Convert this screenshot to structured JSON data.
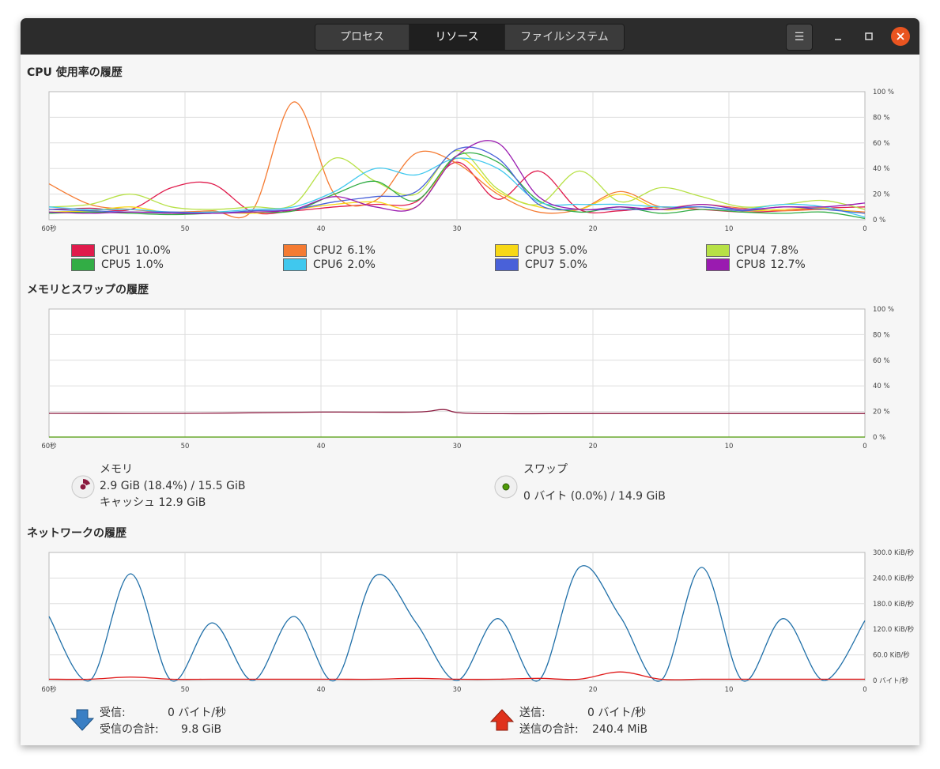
{
  "window": {
    "tabs": [
      {
        "label": "プロセス",
        "active": false
      },
      {
        "label": "リソース",
        "active": true
      },
      {
        "label": "ファイルシステム",
        "active": false
      }
    ],
    "menu_icon": "hamburger-menu-icon",
    "close_icon": "close-icon"
  },
  "cpu": {
    "title": "CPU 使用率の履歴",
    "chart_data": {
      "type": "line",
      "x": [
        60,
        57,
        54,
        51,
        48,
        45,
        42,
        39,
        36,
        33,
        30,
        27,
        24,
        21,
        18,
        15,
        12,
        9,
        6,
        3,
        0
      ],
      "xticks": [
        "60秒",
        "50",
        "40",
        "30",
        "20",
        "10",
        "0"
      ],
      "yticks": [
        "100 %",
        "80 %",
        "60 %",
        "40 %",
        "20 %",
        "0 %"
      ],
      "ylim": [
        0,
        100
      ],
      "series": [
        {
          "name": "CPU1",
          "color": "#e01b4c",
          "values": [
            8,
            9,
            8,
            25,
            28,
            6,
            7,
            10,
            12,
            14,
            45,
            16,
            38,
            8,
            7,
            10,
            8,
            6,
            7,
            9,
            10
          ]
        },
        {
          "name": "CPU2",
          "color": "#f57b32",
          "values": [
            28,
            12,
            8,
            6,
            7,
            8,
            92,
            20,
            15,
            52,
            44,
            20,
            6,
            8,
            22,
            10,
            12,
            9,
            7,
            8,
            6
          ]
        },
        {
          "name": "CPU3",
          "color": "#f7d816",
          "values": [
            6,
            7,
            10,
            5,
            6,
            5,
            8,
            12,
            14,
            10,
            48,
            22,
            10,
            8,
            20,
            8,
            10,
            7,
            8,
            9,
            5
          ]
        },
        {
          "name": "CPU4",
          "color": "#b7e146",
          "values": [
            10,
            12,
            20,
            10,
            8,
            10,
            12,
            48,
            30,
            20,
            54,
            24,
            12,
            38,
            14,
            25,
            18,
            10,
            12,
            15,
            8
          ]
        },
        {
          "name": "CPU5",
          "color": "#32ad45",
          "values": [
            5,
            6,
            5,
            4,
            5,
            6,
            7,
            20,
            30,
            15,
            50,
            45,
            15,
            6,
            10,
            5,
            8,
            6,
            5,
            6,
            1
          ]
        },
        {
          "name": "CPU6",
          "color": "#40c8ee",
          "values": [
            10,
            8,
            8,
            6,
            6,
            8,
            10,
            22,
            40,
            35,
            48,
            40,
            14,
            12,
            12,
            10,
            10,
            8,
            12,
            10,
            2
          ]
        },
        {
          "name": "CPU7",
          "color": "#4961d9",
          "values": [
            8,
            7,
            6,
            6,
            5,
            7,
            8,
            14,
            18,
            22,
            55,
            48,
            12,
            8,
            8,
            8,
            10,
            7,
            10,
            8,
            5
          ]
        },
        {
          "name": "CPU8",
          "color": "#9a1bb0",
          "values": [
            6,
            5,
            6,
            5,
            5,
            6,
            8,
            18,
            10,
            10,
            50,
            60,
            18,
            8,
            10,
            8,
            12,
            8,
            10,
            10,
            13
          ]
        }
      ],
      "legend": [
        {
          "label": "CPU1",
          "value": "10.0%",
          "color": "#e01b4c"
        },
        {
          "label": "CPU2",
          "value": "6.1%",
          "color": "#f57b32"
        },
        {
          "label": "CPU3",
          "value": "5.0%",
          "color": "#f7d816"
        },
        {
          "label": "CPU4",
          "value": "7.8%",
          "color": "#b7e146"
        },
        {
          "label": "CPU5",
          "value": "1.0%",
          "color": "#32ad45"
        },
        {
          "label": "CPU6",
          "value": "2.0%",
          "color": "#40c8ee"
        },
        {
          "label": "CPU7",
          "value": "5.0%",
          "color": "#4961d9"
        },
        {
          "label": "CPU8",
          "value": "12.7%",
          "color": "#9a1bb0"
        }
      ]
    }
  },
  "memory": {
    "title": "メモリとスワップの履歴",
    "chart_data": {
      "type": "line",
      "x": [
        60,
        50,
        40,
        33,
        31,
        29,
        20,
        10,
        0
      ],
      "xticks": [
        "60秒",
        "50",
        "40",
        "30",
        "20",
        "10",
        "0"
      ],
      "yticks": [
        "100 %",
        "80 %",
        "60 %",
        "40 %",
        "20 %",
        "0 %"
      ],
      "ylim": [
        0,
        100
      ],
      "series": [
        {
          "name": "メモリ",
          "color": "#8b1a3f",
          "values": [
            18.5,
            18.5,
            19.5,
            19.5,
            21.5,
            18.5,
            18.4,
            18.4,
            18.4
          ]
        },
        {
          "name": "スワップ",
          "color": "#4e9a06",
          "values": [
            0,
            0,
            0,
            0,
            0,
            0,
            0,
            0,
            0
          ]
        }
      ]
    },
    "mem_label": "メモリ",
    "mem_used": "2.9 GiB (18.4%) / 15.5 GiB",
    "mem_cache": "キャッシュ 12.9 GiB",
    "swap_label": "スワップ",
    "swap_used": "0 バイト (0.0%) / 14.9 GiB",
    "mem_color": "#8b1a3f",
    "swap_color": "#4e9a06",
    "mem_fraction": 0.184,
    "swap_fraction": 0
  },
  "network": {
    "title": "ネットワークの履歴",
    "chart_data": {
      "type": "line",
      "x": [
        60,
        57,
        54,
        51,
        48,
        45,
        42,
        39,
        36,
        33,
        30,
        27,
        24,
        21,
        18,
        15,
        12,
        9,
        6,
        3,
        0
      ],
      "xticks": [
        "60秒",
        "50",
        "40",
        "30",
        "20",
        "10",
        "0"
      ],
      "yticks": [
        "300.0 KiB/秒",
        "240.0 KiB/秒",
        "180.0 KiB/秒",
        "120.0 KiB/秒",
        "60.0 KiB/秒",
        "0 バイト/秒"
      ],
      "ylim": [
        0,
        300
      ],
      "series": [
        {
          "name": "受信",
          "color": "#1f6fa8",
          "values": [
            150,
            0,
            250,
            0,
            135,
            0,
            150,
            0,
            245,
            135,
            0,
            145,
            0,
            265,
            150,
            0,
            265,
            0,
            145,
            0,
            140
          ]
        },
        {
          "name": "送信",
          "color": "#e01b1b",
          "values": [
            3,
            3,
            8,
            3,
            3,
            3,
            3,
            3,
            3,
            5,
            3,
            3,
            5,
            3,
            20,
            3,
            3,
            3,
            3,
            3,
            3
          ]
        }
      ]
    },
    "recv_label": "受信:",
    "recv_rate": "0 バイト/秒",
    "recv_total_label": "受信の合計:",
    "recv_total": "9.8 GiB",
    "send_label": "送信:",
    "send_rate": "0 バイト/秒",
    "send_total_label": "送信の合計:",
    "send_total": "240.4 MiB",
    "recv_color": "#3a7fc4",
    "send_color": "#e0311b"
  }
}
